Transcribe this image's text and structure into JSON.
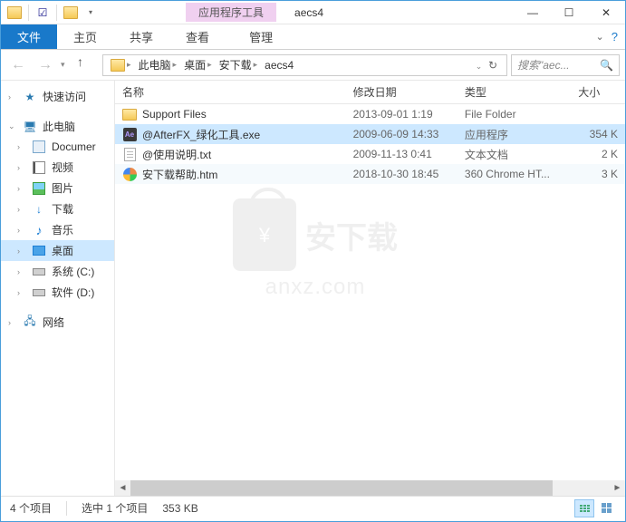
{
  "titlebar": {
    "context_tab": "应用程序工具",
    "title": "aecs4"
  },
  "ribbon": {
    "file": "文件",
    "home": "主页",
    "share": "共享",
    "view": "查看",
    "manage": "管理"
  },
  "breadcrumb": {
    "segments": [
      "此电脑",
      "桌面",
      "安下载",
      "aecs4"
    ]
  },
  "search": {
    "placeholder": "搜索\"aec..."
  },
  "sidebar": {
    "quick_access": "快速访问",
    "this_pc": "此电脑",
    "documents": "Documer",
    "videos": "视频",
    "pictures": "图片",
    "downloads": "下载",
    "music": "音乐",
    "desktop": "桌面",
    "drive_c": "系统 (C:)",
    "drive_d": "软件 (D:)",
    "network": "网络"
  },
  "columns": {
    "name": "名称",
    "date": "修改日期",
    "type": "类型",
    "size": "大小"
  },
  "files": [
    {
      "name": "Support Files",
      "date": "2013-09-01 1:19",
      "type": "File Folder",
      "size": ""
    },
    {
      "name": "@AfterFX_绿化工具.exe",
      "date": "2009-06-09 14:33",
      "type": "应用程序",
      "size": "354 K"
    },
    {
      "name": "@使用说明.txt",
      "date": "2009-11-13 0:41",
      "type": "文本文档",
      "size": "2 K"
    },
    {
      "name": "安下载帮助.htm",
      "date": "2018-10-30 18:45",
      "type": "360 Chrome HT...",
      "size": "3 K"
    }
  ],
  "watermark": {
    "line1": "安下载",
    "line2": "anxz.com"
  },
  "statusbar": {
    "count": "4 个项目",
    "selection": "选中 1 个项目",
    "size": "353 KB"
  }
}
